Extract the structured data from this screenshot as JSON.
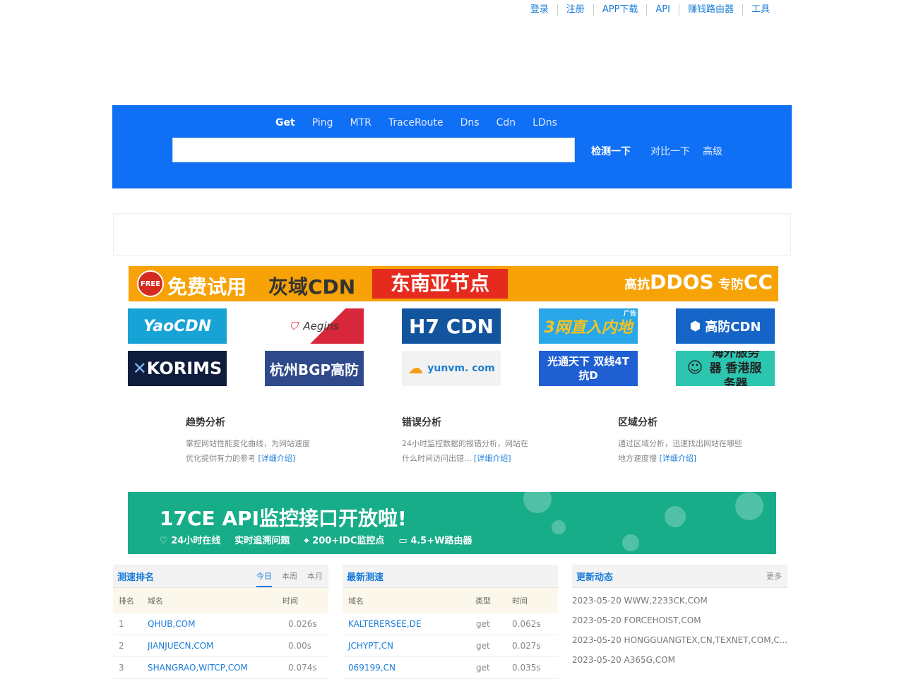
{
  "topnav": [
    "登录",
    "注册",
    "APP下载",
    "API",
    "赚钱路由器",
    "工具"
  ],
  "search": {
    "tabs": [
      "Get",
      "Ping",
      "MTR",
      "TraceRoute",
      "Dns",
      "Cdn",
      "LDns"
    ],
    "active_tab": "Get",
    "input_value": "",
    "check_label": "检测一下",
    "compare_label": "对比一下",
    "advanced_label": "高级"
  },
  "banner_top": {
    "badge": "FREE",
    "t1": "免费试用",
    "t2": "灰域CDN",
    "t3": "东南亚节点",
    "t4_prefix": "高抗",
    "t4_big1": "DDOS",
    "t4_mid": "专防",
    "t4_big2": "CC"
  },
  "ads": {
    "row1": [
      "YaoCDN",
      "Aegins",
      "H7 CDN",
      "3网直入内地",
      "高防CDN"
    ],
    "row2": [
      "KORIMS",
      "杭州BGP高防",
      "yunvm. com",
      "光通天下 双线4T抗D",
      "海外服务器 香港服务器"
    ],
    "ad_badge": "广告"
  },
  "features": [
    {
      "title": "趋势分析",
      "line1": "掌控网站性能变化曲线，为网站速度",
      "line2": "优化提供有力的参考 ",
      "link": "[详细介绍]"
    },
    {
      "title": "错误分析",
      "line1": "24小时监控数据的报错分析，网站在",
      "line2": "什么时间访问出错... ",
      "link": "[详细介绍]"
    },
    {
      "title": "区域分析",
      "line1": "通过区域分析，迅速找出网站在哪些",
      "line2": "地方速度慢 ",
      "link": "[详细介绍]"
    }
  ],
  "api_banner": {
    "title": "17CE  API监控接口开放啦!",
    "items": [
      "24小时在线",
      "实时追溯问题",
      "200+IDC监控点",
      "4.5+W路由器"
    ]
  },
  "ranking": {
    "title": "测速排名",
    "tabs": [
      "今日",
      "本周",
      "本月"
    ],
    "active_tab": "今日",
    "headers": [
      "排名",
      "域名",
      "时间"
    ],
    "rows": [
      {
        "rank": "1",
        "domain": "QHUB,COM",
        "time": "0.026s"
      },
      {
        "rank": "2",
        "domain": "JIANJUECN,COM",
        "time": "0.00s"
      },
      {
        "rank": "3",
        "domain": "SHANGRAO,WITCP,COM",
        "time": "0.074s"
      }
    ]
  },
  "latest": {
    "title": "最新测速",
    "headers": [
      "域名",
      "类型",
      "时间"
    ],
    "rows": [
      {
        "domain": "KALTERERSEE,DE",
        "type": "get",
        "time": "0.062s"
      },
      {
        "domain": "JCHYPT,CN",
        "type": "get",
        "time": "0.027s"
      },
      {
        "domain": "069199,CN",
        "type": "get",
        "time": "0.035s"
      }
    ]
  },
  "updates": {
    "title": "更新动态",
    "more": "更多",
    "items": [
      "2023-05-20 WWW,2233CK,COM",
      "2023-05-20 FORCEHOIST,COM",
      "2023-05-20 HONGGUANGTEX,CN,TEXNET,COM,C...",
      "2023-05-20 A365G,COM"
    ]
  },
  "colors": {
    "brand_blue": "#0f6ff5",
    "link": "#1a7cd9",
    "banner_orange": "#f7a206",
    "api_green": "#17ad89"
  }
}
